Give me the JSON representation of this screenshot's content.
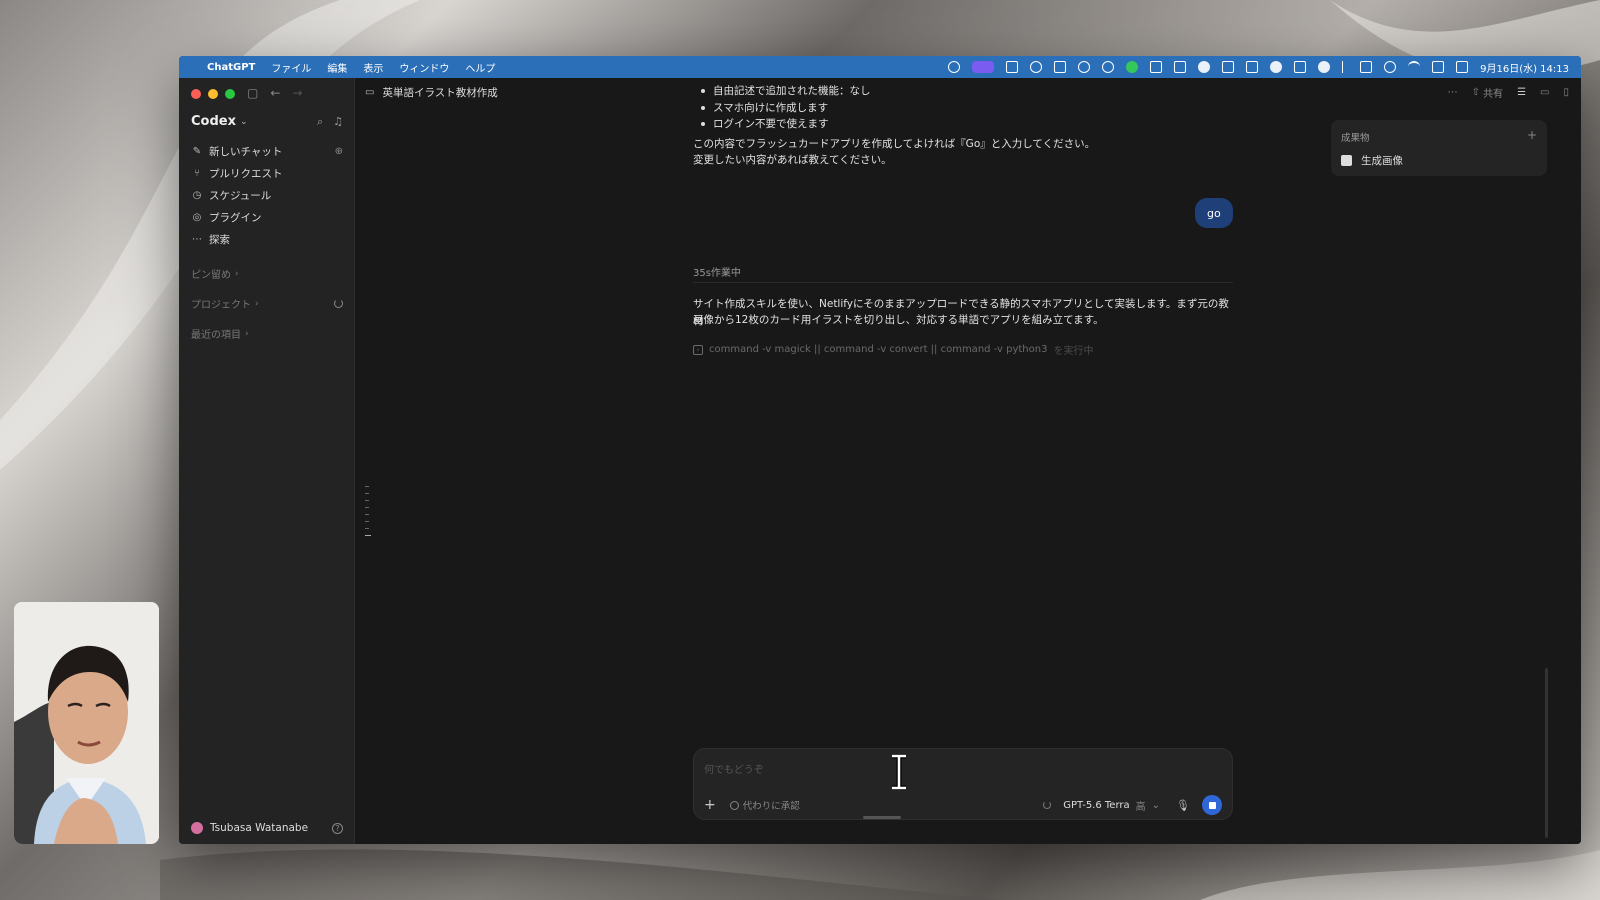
{
  "menubar": {
    "app_name": "ChatGPT",
    "menus": [
      "ファイル",
      "編集",
      "表示",
      "ウィンドウ",
      "ヘルプ"
    ],
    "clock": "9月16日(水) 14:13"
  },
  "sidebar": {
    "title": "Codex",
    "nav": [
      {
        "label": "新しいチャット",
        "icon": "compose-icon"
      },
      {
        "label": "プルリクエスト",
        "icon": "pull-request-icon"
      },
      {
        "label": "スケジュール",
        "icon": "clock-icon"
      },
      {
        "label": "プラグイン",
        "icon": "plugin-icon"
      },
      {
        "label": "探索",
        "icon": "ellipsis-icon"
      }
    ],
    "sections": {
      "pinned": "ピン留め",
      "projects": "プロジェクト",
      "recent": "最近の項目"
    },
    "user_name": "Tsubasa Watanabe"
  },
  "topbar": {
    "project_title": "英単語イラスト教材作成",
    "share_label": "共有"
  },
  "conversation": {
    "bullets": [
      "自由記述で追加された機能：なし",
      "スマホ向けに作成します",
      "ログイン不要で使えます"
    ],
    "confirm_line1": "この内容でフラッシュカードアプリを作成してよければ『Go』と入力してください。",
    "confirm_line2": "変更したい内容があれば教えてください。",
    "user_message": "go",
    "working_status": "35s作業中",
    "reply_line1": "サイト作成スキルを使い、Netlifyにそのままアップロードできる静的スマホアプリとして実装します。まず元の教材",
    "reply_line2": "画像から12枚のカード用イラストを切り出し、対応する単語でアプリを組み立てます。",
    "command": "command -v magick || command -v convert || command -v python3",
    "command_suffix": "を実行中"
  },
  "artifacts": {
    "header": "成果物",
    "item": "生成画像"
  },
  "composer": {
    "placeholder": "何でもどうぞ",
    "approve_label": "代わりに承認",
    "model": "GPT-5.6 Terra",
    "level": "高"
  }
}
